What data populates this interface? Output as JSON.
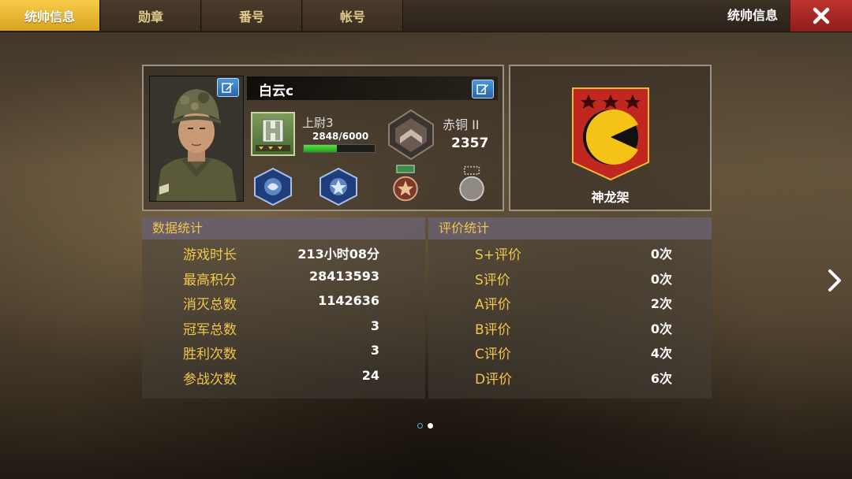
{
  "tabs": [
    {
      "label": "统帅信息",
      "active": true
    },
    {
      "label": "勋章",
      "active": false
    },
    {
      "label": "番号",
      "active": false
    },
    {
      "label": "帐号",
      "active": false
    }
  ],
  "header": {
    "title": "统帅信息",
    "close_icon": "close-icon"
  },
  "profile": {
    "name": "白云c",
    "rank": "上尉3",
    "xp_text": "2848/6000",
    "xp_fraction": 0.47,
    "league": "赤铜 II",
    "league_score": "2357",
    "medals": [
      "sapphire-medal-icon",
      "sapphire-star-medal-icon",
      "bronze-star-medal-icon",
      "empty-medal-slot-icon"
    ]
  },
  "legion": {
    "name": "神龙架",
    "stars": 3
  },
  "data_stats": {
    "title": "数据统计",
    "rows": [
      {
        "label": "游戏时长",
        "value": "213小时08分"
      },
      {
        "label": "最高积分",
        "value": "28413593"
      },
      {
        "label": "消灭总数",
        "value": "1142636"
      },
      {
        "label": "冠军总数",
        "value": "3"
      },
      {
        "label": "胜利次数",
        "value": "3"
      },
      {
        "label": "参战次数",
        "value": "24"
      }
    ]
  },
  "rating_stats": {
    "title": "评价统计",
    "rows": [
      {
        "label": "S+评价",
        "value": "0次"
      },
      {
        "label": "S评价",
        "value": "0次"
      },
      {
        "label": "A评价",
        "value": "2次"
      },
      {
        "label": "B评价",
        "value": "0次"
      },
      {
        "label": "C评价",
        "value": "4次"
      },
      {
        "label": "D评价",
        "value": "6次"
      }
    ]
  },
  "pagination": {
    "pages": 2,
    "current": 2
  },
  "colors": {
    "accent_gold": "#f0c64c",
    "tab_active": "#f0b930",
    "close_red": "#b02a27",
    "xp_green": "#3fc232"
  }
}
